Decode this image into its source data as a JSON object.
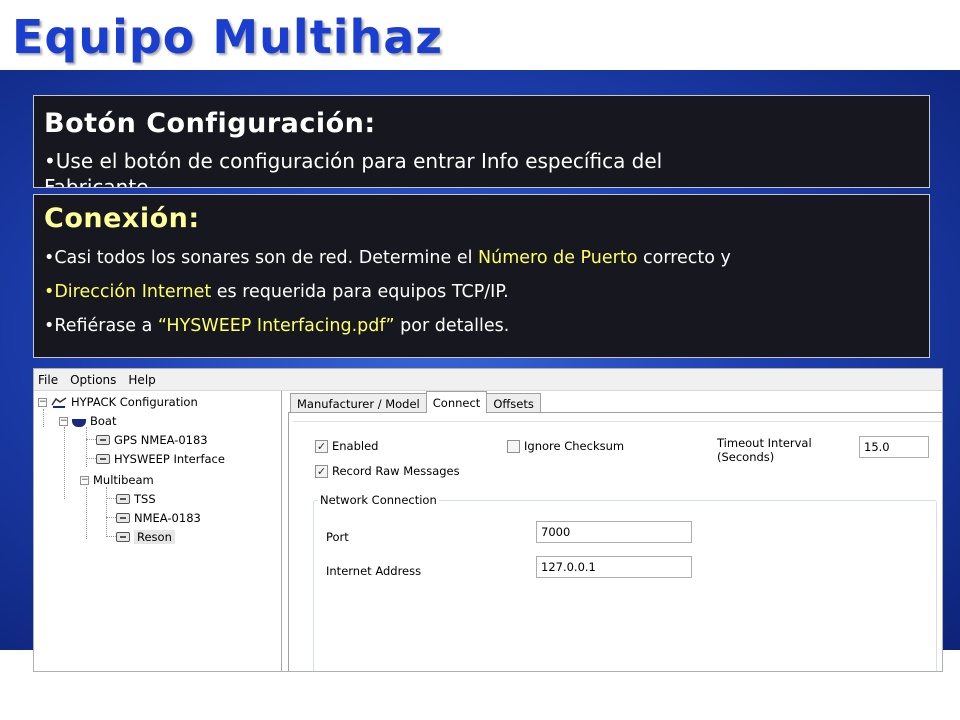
{
  "slide": {
    "title": "Equipo Multihaz"
  },
  "box1": {
    "heading": "Botón Configuración:",
    "line1": "•Use el botón de configuración para entrar Info específica del",
    "line1_cont": "Fabricante"
  },
  "box2": {
    "heading": "Conexión:",
    "b1_prefix": "•Casi todos los sonares son de red.  Determine el ",
    "b1_highlight": "Número de Puerto",
    "b1_suffix": "  correcto y",
    "b2_bullet": "•",
    "b2_highlight": "Dirección Internet",
    "b2_suffix": " es requerida para equipos TCP/IP.",
    "b3_prefix": "•Refiérase a ",
    "b3_highlight": "“HYSWEEP Interfacing.pdf”",
    "b3_suffix": " por detalles."
  },
  "app": {
    "menu": [
      "File",
      "Options",
      "Help"
    ],
    "tree": {
      "root": "HYPACK Configuration",
      "boat": "Boat",
      "gps": "GPS NMEA-0183",
      "hysweep": "HYSWEEP Interface",
      "multibeam": "Multibeam",
      "tss": "TSS",
      "nmea": "NMEA-0183",
      "reson": "Reson"
    },
    "tabs": [
      "Manufacturer / Model",
      "Connect",
      "Offsets"
    ],
    "active_tab": "Connect",
    "connect": {
      "enabled_label": "Enabled",
      "enabled_checked": true,
      "record_raw_label": "Record Raw Messages",
      "record_raw_checked": true,
      "ignore_checksum_label": "Ignore Checksum",
      "ignore_checksum_checked": false,
      "timeout_label_1": "Timeout Interval",
      "timeout_label_2": "(Seconds)",
      "timeout_value": "15.0",
      "network_group": "Network Connection",
      "port_label": "Port",
      "port_value": "7000",
      "internet_label": "Internet Address",
      "internet_value": "127.0.0.1"
    }
  },
  "colors": {
    "title": "#1a3fd0",
    "box_bg": "#17181f",
    "highlight": "#ffff66",
    "heading2": "#ffff99",
    "slide_bg": "#1d3fb0"
  }
}
